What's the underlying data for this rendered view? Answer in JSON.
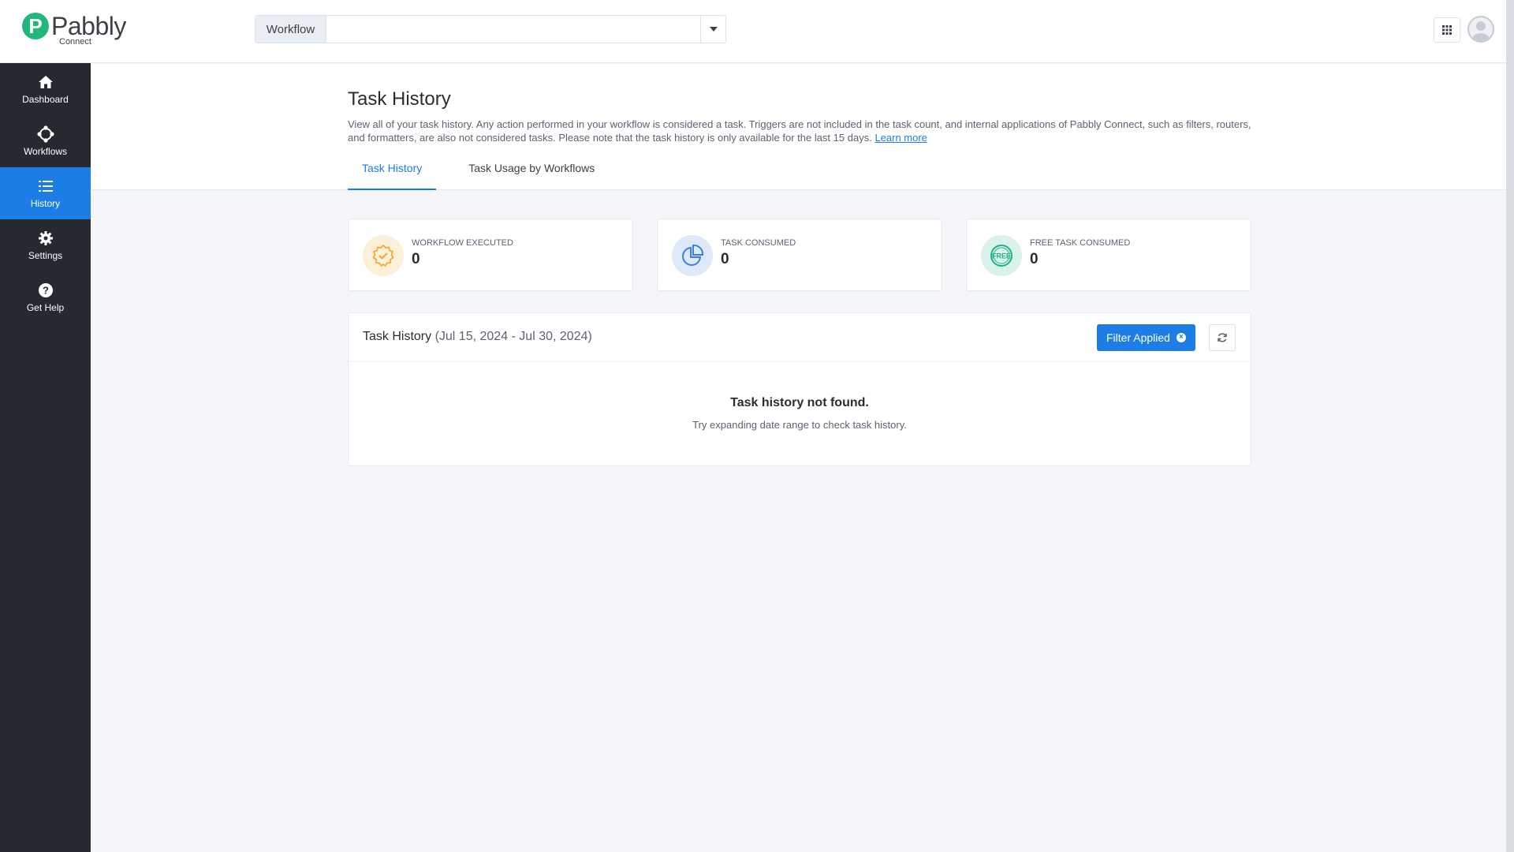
{
  "header": {
    "logo_word": "Pabbly",
    "logo_sub": "Connect",
    "workflow_label": "Workflow",
    "workflow_value": ""
  },
  "sidebar": {
    "items": [
      {
        "label": "Dashboard",
        "icon": "home-icon"
      },
      {
        "label": "Workflows",
        "icon": "workflows-icon"
      },
      {
        "label": "History",
        "icon": "history-list-icon",
        "active": true
      },
      {
        "label": "Settings",
        "icon": "gear-icon"
      },
      {
        "label": "Get Help",
        "icon": "help-icon"
      }
    ]
  },
  "page": {
    "title": "Task History",
    "description": "View all of your task history. Any action performed in your workflow is considered a task. Triggers are not included in the task count, and internal applications of Pabbly Connect, such as filters, routers, and formatters, are also not considered tasks. Please note that the task history is only available for the last 15 days.",
    "learn_more": "Learn more",
    "tabs": [
      {
        "label": "Task History",
        "active": true
      },
      {
        "label": "Task Usage by Workflows",
        "active": false
      }
    ]
  },
  "stats": [
    {
      "label": "WORKFLOW EXECUTED",
      "value": "0",
      "icon": "badge-check-icon",
      "color": "#f2a93b"
    },
    {
      "label": "TASK CONSUMED",
      "value": "0",
      "icon": "pie-chart-icon",
      "color": "#3d7fe0"
    },
    {
      "label": "FREE TASK CONSUMED",
      "value": "0",
      "icon": "free-badge-icon",
      "color": "#20b08a"
    }
  ],
  "history_panel": {
    "title": "Task History",
    "range": "(Jul 15, 2024 - Jul 30, 2024)",
    "filter_button": "Filter Applied",
    "empty_title": "Task history not found.",
    "empty_subtitle": "Try expanding date range to check task history."
  },
  "colors": {
    "accent": "#1c7de6",
    "sidebar_bg": "#252a31",
    "brand_green": "#21b77a"
  }
}
